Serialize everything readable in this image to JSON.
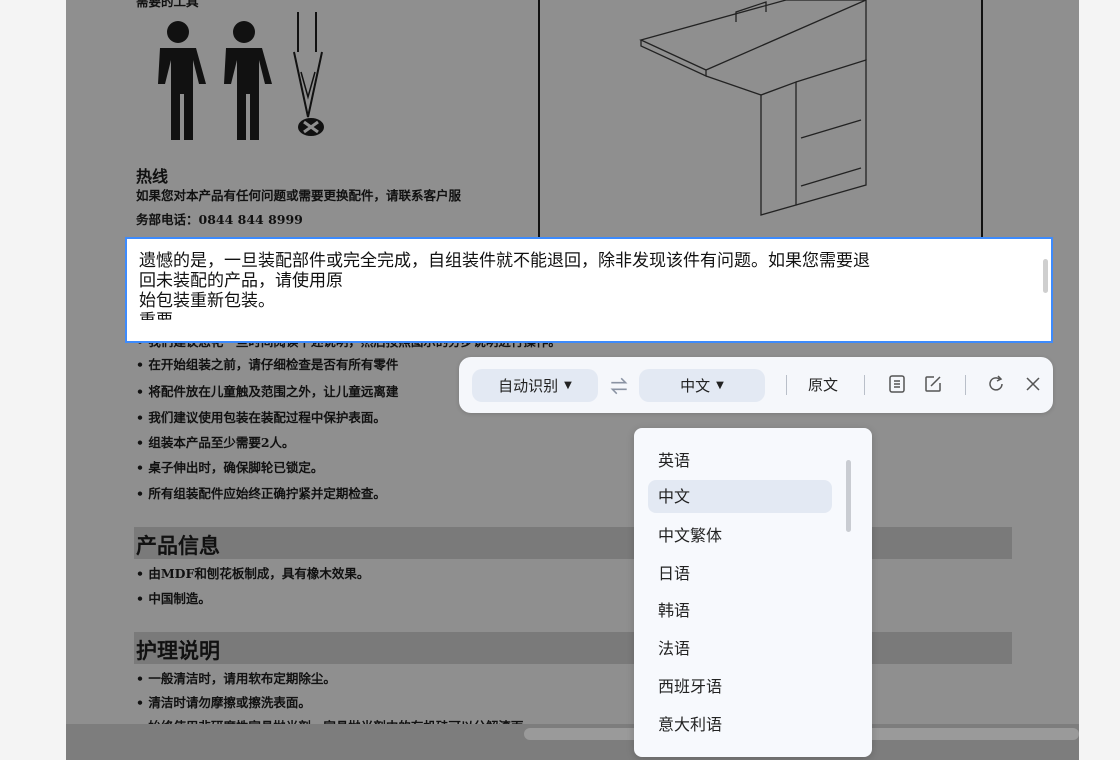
{
  "document": {
    "heading_top": "需要的工具",
    "hotline_title": "热线",
    "hotline_line1": "如果您对本产品有任何问题或需要更换配件，请联系客户服",
    "hotline_line2": "务部电话：0844 844 8999",
    "hidden_line": "• 我们建议您花一些时间阅读下述说明，然后按照图示的分步说明进行操作。",
    "bullets": [
      "• 在开始组装之前，请仔细检查是否有所有零件",
      "• 将配件放在儿童触及范围之外，让儿童远离建",
      "• 我们建议使用包装在装配过程中保护表面。",
      "• 组装本产品至少需要2人。",
      "• 桌子伸出时，确保脚轮已锁定。",
      "• 所有组装配件应始终正确拧紧并定期检查。"
    ],
    "product_info_title": "产品信息",
    "product_info_items": [
      "• 由MDF和刨花板制成，具有橡木效果。",
      "• 中国制造。"
    ],
    "care_title": "护理说明",
    "care_items": [
      "• 一般清洁时，请用软布定期除尘。",
      "• 清洁时请勿摩擦或擦洗表面。",
      "• 始终使用非研磨性家具抛光剂，家具抛光剂中的有机硅可以分解漆面。"
    ]
  },
  "translation": {
    "line1": "遗憾的是，一旦装配部件或完全完成，自组装件就不能退回，除非发现该件有问题。如果您需要退",
    "line2": "回未装配的产品，请使用原",
    "line3": "始包装重新包装。",
    "line4": "重要"
  },
  "toolbar": {
    "source_lang": "自动识别",
    "target_lang": "中文",
    "original_label": "原文",
    "icons": [
      "swap-icon",
      "copy-icon",
      "edit-icon",
      "refresh-icon",
      "close-icon"
    ]
  },
  "language_menu": {
    "options": [
      "英语",
      "中文",
      "中文繁体",
      "日语",
      "韩语",
      "法语",
      "西班牙语",
      "意大利语"
    ],
    "selected": "中文"
  },
  "colors": {
    "accent_border": "#3d8bfd",
    "toolbar_bg": "#f5f7fb",
    "pill_bg": "#e3e9f3"
  }
}
